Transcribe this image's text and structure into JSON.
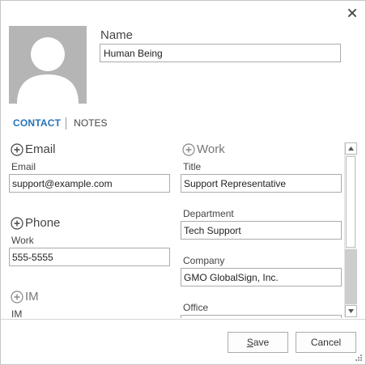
{
  "name": {
    "label": "Name",
    "value": "Human Being"
  },
  "tabs": [
    {
      "label": "CONTACT",
      "active": true
    },
    {
      "label": "NOTES",
      "active": false
    }
  ],
  "left_column": {
    "email": {
      "section_label": "Email",
      "field_label": "Email",
      "value": "support@example.com"
    },
    "phone": {
      "section_label": "Phone",
      "field_label": "Work",
      "value": "555-5555"
    },
    "im": {
      "section_label": "IM",
      "field_label": "IM"
    }
  },
  "right_column": {
    "work": {
      "section_label": "Work"
    },
    "title": {
      "field_label": "Title",
      "value": "Support Representative"
    },
    "department": {
      "field_label": "Department",
      "value": "Tech Support"
    },
    "company": {
      "field_label": "Company",
      "value": "GMO GlobalSign, Inc."
    },
    "office": {
      "field_label": "Office"
    }
  },
  "buttons": {
    "save_first": "S",
    "save_rest": "ave",
    "cancel": "Cancel"
  },
  "icons": {
    "close": "close-icon",
    "add": "plus-circle-icon",
    "avatar": "person-silhouette-icon",
    "scroll_up": "chevron-up-icon",
    "scroll_down": "chevron-down-icon",
    "resize": "resize-grip-icon"
  },
  "colors": {
    "accent": "#2672b9",
    "avatar_bg": "#b5b5b5",
    "border": "#ababab"
  }
}
